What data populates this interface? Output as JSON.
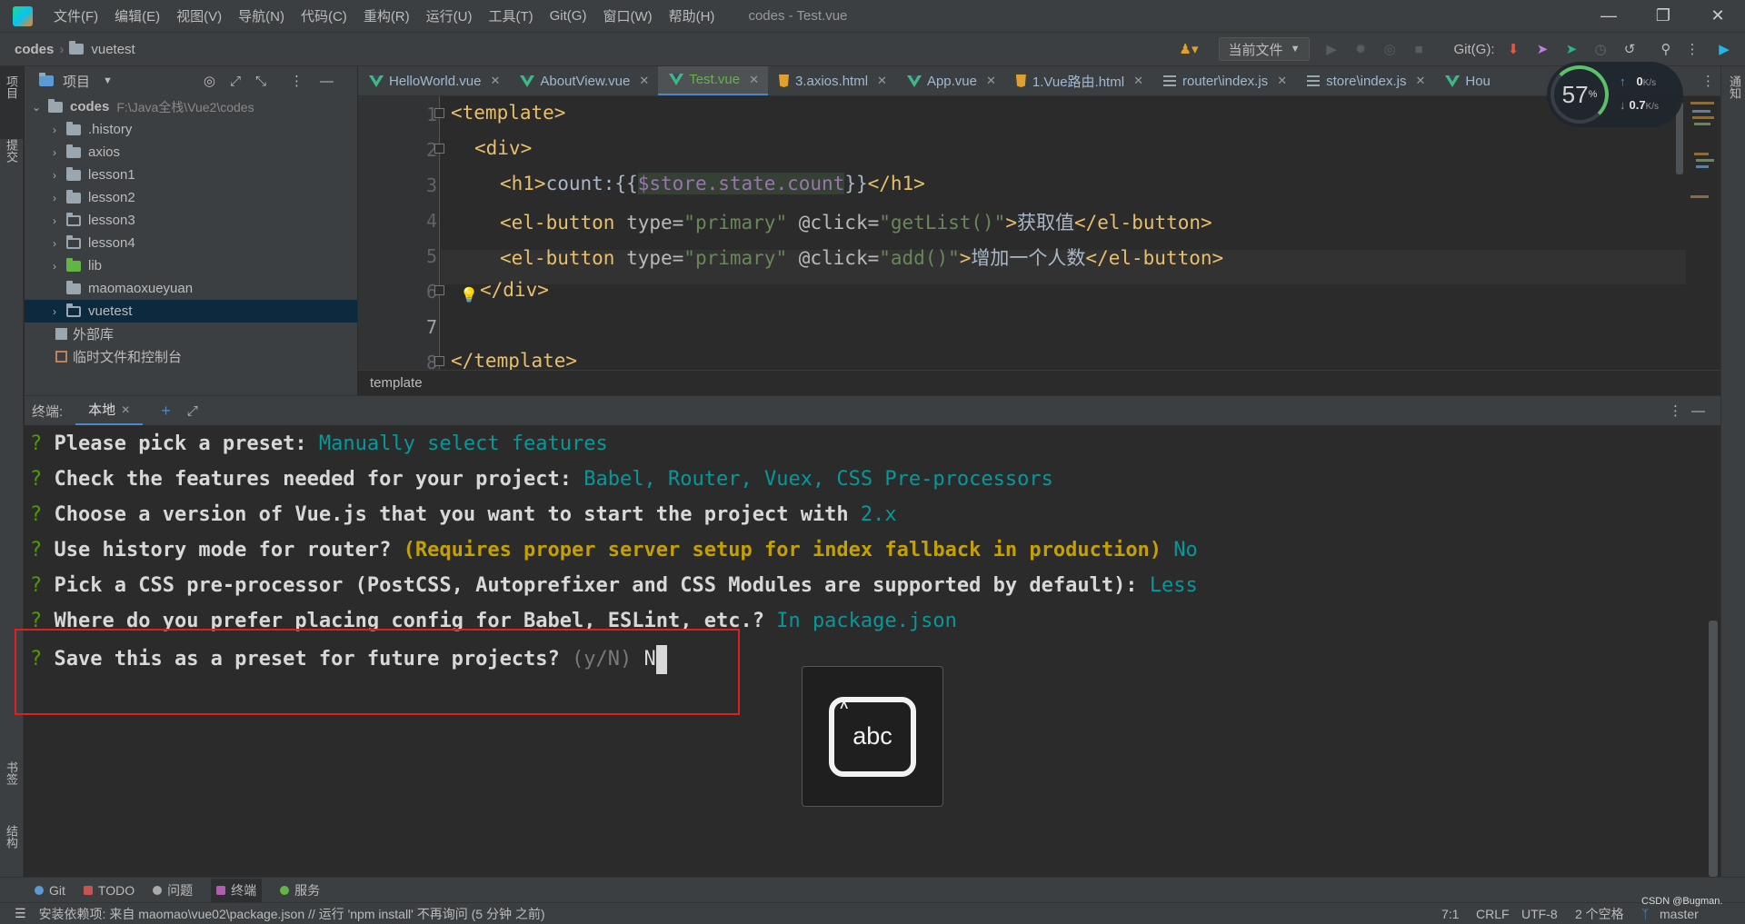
{
  "window": {
    "title": "codes - Test.vue",
    "menu": [
      "文件(F)",
      "编辑(E)",
      "视图(V)",
      "导航(N)",
      "代码(C)",
      "重构(R)",
      "运行(U)",
      "工具(T)",
      "Git(G)",
      "窗口(W)",
      "帮助(H)"
    ]
  },
  "navbar": {
    "root": "codes",
    "folder": "vuetest",
    "run_config": "当前文件",
    "git_label": "Git(G):"
  },
  "left_strip": {
    "project": "项目",
    "commit": "提交",
    "bookmarks": "书签",
    "structure": "结构"
  },
  "right_strip": {
    "notifications": "通知"
  },
  "project_panel": {
    "title": "项目",
    "root": {
      "name": "codes",
      "path": "F:\\Java全栈\\Vue2\\codes"
    },
    "items": [
      {
        "name": ".history"
      },
      {
        "name": "axios"
      },
      {
        "name": "lesson1"
      },
      {
        "name": "lesson2"
      },
      {
        "name": "lesson3"
      },
      {
        "name": "lesson4"
      },
      {
        "name": "lib"
      },
      {
        "name": "maomaoxueyuan"
      },
      {
        "name": "vuetest"
      }
    ],
    "external": "外部库",
    "scratches": "临时文件和控制台"
  },
  "tabs": [
    {
      "label": "HelloWorld.vue",
      "icon": "vue-icon"
    },
    {
      "label": "AboutView.vue",
      "icon": "vue-icon"
    },
    {
      "label": "Test.vue",
      "icon": "vue-icon",
      "active": true
    },
    {
      "label": "3.axios.html",
      "icon": "html-icon"
    },
    {
      "label": "App.vue",
      "icon": "vue-icon"
    },
    {
      "label": "1.Vue路由.html",
      "icon": "html-icon"
    },
    {
      "label": "router\\index.js",
      "icon": "js-icon"
    },
    {
      "label": "store\\index.js",
      "icon": "js-icon"
    },
    {
      "label": "Hou",
      "icon": "vue-icon"
    }
  ],
  "editor": {
    "line_numbers": [
      "1",
      "2",
      "3",
      "4",
      "5",
      "6",
      "7",
      "8"
    ],
    "lines": {
      "l1_tag": "<template>",
      "l2_tag": "<div>",
      "l3_open": "<h1>",
      "l3_text": "count:{{",
      "l3_expr": "$store.state.count",
      "l3_close_text": "}}",
      "l3_close": "</h1>",
      "l4_open": "<el-button",
      "l4_attr1": " type=",
      "l4_val1": "\"primary\"",
      "l4_attr2": " @click=",
      "l4_val2": "\"getList()\"",
      "l4_gt": ">",
      "l4_text": "获取值",
      "l4_close": "</el-button>",
      "l5_open": "<el-button",
      "l5_attr1": " type=",
      "l5_val1": "\"primary\"",
      "l5_attr2": " @click=",
      "l5_val2": "\"add()\"",
      "l5_gt": ">",
      "l5_text": "增加一个人数",
      "l5_close": "</el-button>",
      "l6_tag": "</div>",
      "l8_tag": "</template>"
    },
    "breadcrumb": "template"
  },
  "terminal": {
    "title": "终端:",
    "tab": "本地",
    "lines": [
      {
        "q": "?",
        "text": " Please pick a preset: ",
        "ans": "Manually select features"
      },
      {
        "q": "?",
        "text": " Check the features needed for your project: ",
        "ans": "Babel, Router, Vuex, CSS Pre-processors"
      },
      {
        "q": "?",
        "text": " Choose a version of Vue.js that you want to start the project with ",
        "ans": "2.x"
      },
      {
        "q": "?",
        "text": " Use history mode for router? ",
        "warn": "(Requires proper server setup for index fallback in production)",
        "ans": " No"
      },
      {
        "q": "?",
        "text": " Pick a CSS pre-processor (PostCSS, Autoprefixer and CSS Modules are supported by default): ",
        "ans": "Less"
      },
      {
        "q": "?",
        "text": " Where do you prefer placing config for Babel, ESLint, etc.? ",
        "ans": "In package.json"
      },
      {
        "q": "?",
        "text": " Save this as a preset for future projects? ",
        "dim": "(y/N)",
        "input": " N"
      }
    ]
  },
  "ime": {
    "label": "abc"
  },
  "bottom_tools": [
    {
      "label": "Git",
      "color": "#5a9bd5"
    },
    {
      "label": "TODO",
      "color": "#c75450"
    },
    {
      "label": "问题",
      "color": "#aaaaaa"
    },
    {
      "label": "终端",
      "color": "#b05fb0",
      "active": true
    },
    {
      "label": "服务",
      "color": "#62b543"
    }
  ],
  "status": {
    "message": "安装依赖项: 来自 maomao\\vue02\\package.json // 运行 'npm install'  不再询问 (5 分钟 之前)",
    "position": "7:1",
    "line_sep": "CRLF",
    "encoding": "UTF-8",
    "indent": "2 个空格",
    "branch": "master",
    "watermark": "CSDN @Bugman."
  },
  "net_monitor": {
    "percent": "57",
    "pct_sign": "%",
    "up": "0",
    "down": "0.7",
    "unit": "K/s"
  }
}
